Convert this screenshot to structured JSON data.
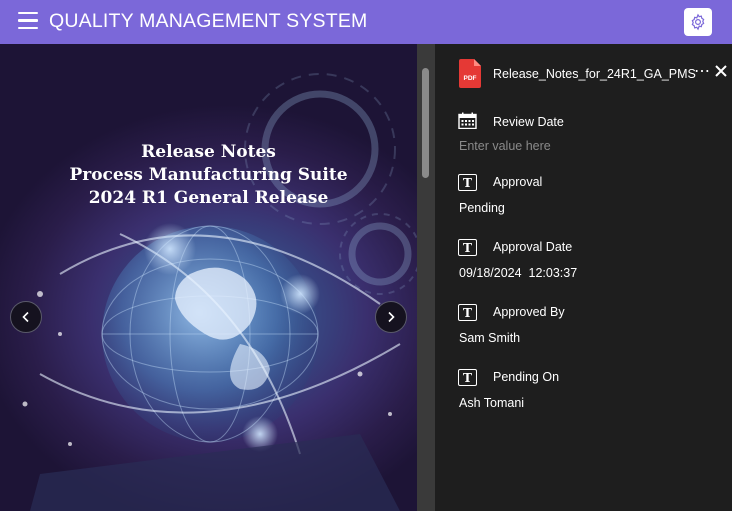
{
  "header": {
    "title": "QUALITY MANAGEMENT SYSTEM",
    "accent_color": "#7b68d9",
    "menu_icon": "hamburger-menu-icon",
    "settings_icon": "gear-icon"
  },
  "viewer": {
    "cover_lines": [
      "Release Notes",
      "Process Manufacturing Suite",
      "2024 R1 General Release"
    ],
    "prev_icon": "chevron-left-icon",
    "next_icon": "chevron-right-icon"
  },
  "panel": {
    "file": {
      "icon": "pdf-file-icon",
      "badge": "PDF",
      "name": "Release_Notes_for_24R1_GA_PMS",
      "more_label": "⋯",
      "close_icon": "close-icon"
    },
    "fields": [
      {
        "label": "Review Date",
        "icon": "calendar-icon",
        "placeholder": "Enter value here",
        "value": ""
      },
      {
        "label": "Approval",
        "icon": "text-field-icon",
        "value": "Pending"
      },
      {
        "label": "Approval Date",
        "icon": "text-field-icon",
        "value": "09/18/2024  12:03:37"
      },
      {
        "label": "Approved By",
        "icon": "text-field-icon",
        "value": "Sam Smith"
      },
      {
        "label": "Pending On",
        "icon": "text-field-icon",
        "value": "Ash Tomani"
      }
    ]
  }
}
